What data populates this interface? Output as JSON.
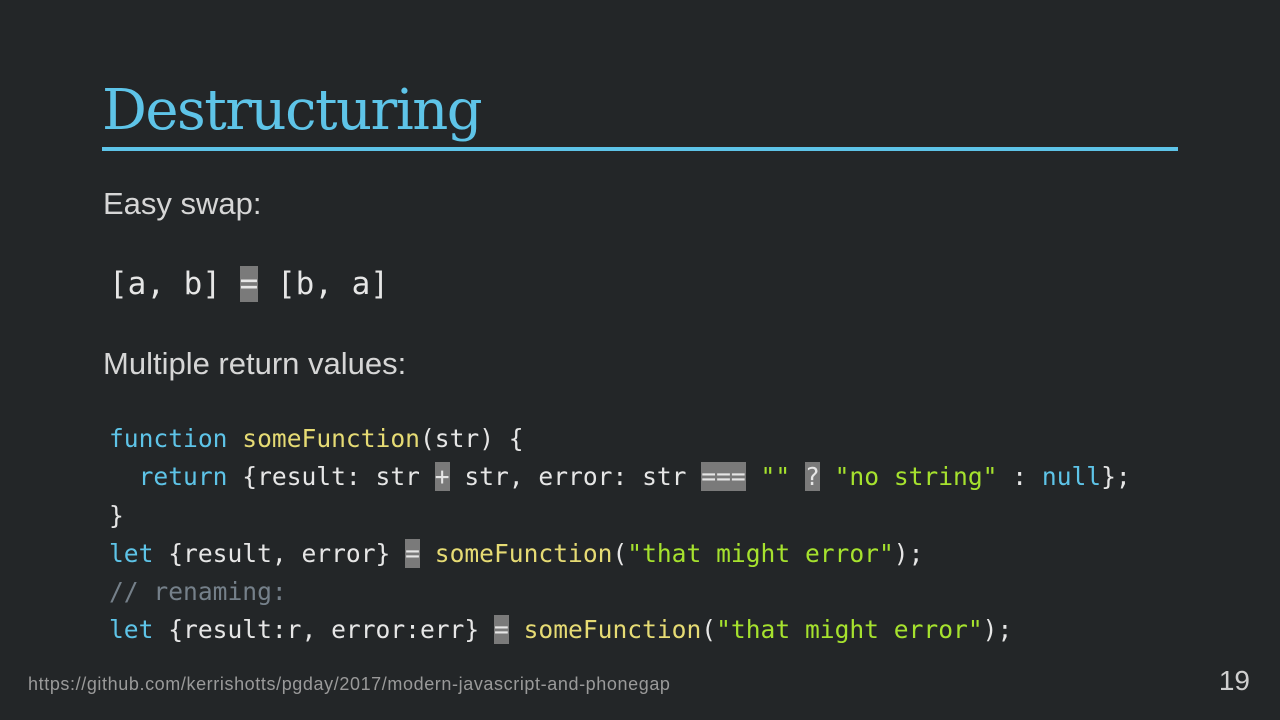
{
  "slide": {
    "title": "Destructuring",
    "intro_swap": "Easy swap:",
    "intro_return": "Multiple return values:",
    "footer_url": "https://github.com/kerrishotts/pgday/2017/modern-javascript-and-phonegap",
    "page_number": "19"
  },
  "code_swap": {
    "line1": {
      "a": "[a, b] ",
      "op": "=",
      "b": " [b, a]"
    }
  },
  "code_return": {
    "line1": {
      "kw": "function",
      "sp1": " ",
      "fn": "someFunction",
      "rest": "(str) {"
    },
    "line2": {
      "indent": "  ",
      "kw": "return",
      "t1": " {result: str ",
      "op1": "+",
      "t2": " str, error: str ",
      "op2": "===",
      "t3": " ",
      "s1": "\"\"",
      "t4": " ",
      "op3": "?",
      "t5": " ",
      "s2": "\"no string\"",
      "t6": " : ",
      "kw2": "null",
      "t7": "};"
    },
    "line3": {
      "text": "}"
    },
    "line4": {
      "kw": "let",
      "t1": " {result, error} ",
      "op": "=",
      "t2": " ",
      "fn": "someFunction",
      "t3": "(",
      "s": "\"that might error\"",
      "t4": ");"
    },
    "line5": {
      "comment": "// renaming:"
    },
    "line6": {
      "kw": "let",
      "t1": " {result:r, error:err} ",
      "op": "=",
      "t2": " ",
      "fn": "someFunction",
      "t3": "(",
      "s": "\"that might error\"",
      "t4": ");"
    }
  },
  "colors": {
    "background": "#232628",
    "accent": "#5ec4e8",
    "function_name": "#e6db74",
    "string": "#a6e22e",
    "comment": "#75808a",
    "operator_highlight": "#7a7a7a"
  }
}
